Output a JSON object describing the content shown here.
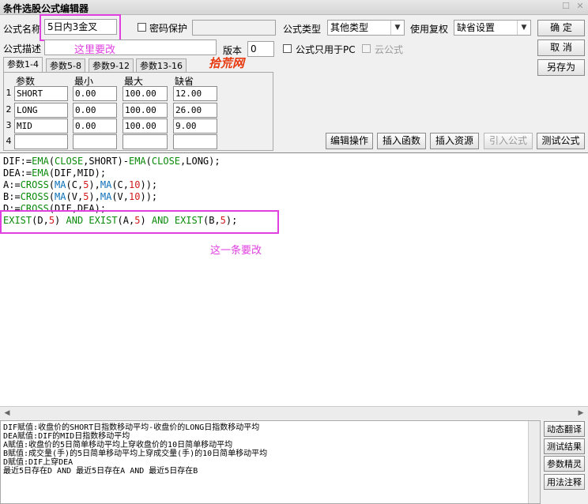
{
  "window": {
    "title": "条件选股公式编辑器",
    "restore_glyph": "☐",
    "close_glyph": "✕"
  },
  "form": {
    "name_label": "公式名称",
    "name_value": "5日内3金叉",
    "password_label": "密码保护",
    "type_label": "公式类型",
    "type_value": "其他类型",
    "rights_label": "使用复权",
    "rights_value": "缺省设置",
    "desc_label": "公式描述",
    "version_label": "版本",
    "version_value": "0",
    "pc_only_label": "公式只用于PC",
    "cloud_label": "云公式"
  },
  "buttons": {
    "ok": "确  定",
    "cancel": "取  消",
    "save_as": "另存为",
    "edit_op": "编辑操作",
    "insert_func": "插入函数",
    "insert_res": "插入资源",
    "import_formula": "引入公式",
    "test_formula": "测试公式",
    "dyn_translate": "动态翻译",
    "test_result": "测试结果",
    "param_wizard": "参数精灵",
    "usage_note": "用法注释"
  },
  "tabs": [
    "参数1-4",
    "参数5-8",
    "参数9-12",
    "参数13-16"
  ],
  "params": {
    "headers": [
      "参数",
      "最小",
      "最大",
      "缺省"
    ],
    "rows": [
      {
        "num": "1",
        "name": "SHORT",
        "min": "0.00",
        "max": "100.00",
        "def": "12.00"
      },
      {
        "num": "2",
        "name": "LONG",
        "min": "0.00",
        "max": "100.00",
        "def": "26.00"
      },
      {
        "num": "3",
        "name": "MID",
        "min": "0.00",
        "max": "100.00",
        "def": "9.00"
      },
      {
        "num": "4",
        "name": "",
        "min": "",
        "max": "",
        "def": ""
      }
    ]
  },
  "code": {
    "l1": [
      "DIF:=",
      "EMA",
      "(",
      "CLOSE",
      ",SHORT)-",
      "EMA",
      "(",
      "CLOSE",
      ",LONG);"
    ],
    "l2": [
      "DEA:=",
      "EMA",
      "(DIF,MID);"
    ],
    "l3": [
      "A:=",
      "CROSS",
      "(",
      "MA",
      "(C,",
      "5",
      "),",
      "MA",
      "(C,",
      "10",
      "));"
    ],
    "l4": [
      "B:=",
      "CROSS",
      "(",
      "MA",
      "(V,",
      "5",
      "),",
      "MA",
      "(V,",
      "10",
      "));"
    ],
    "l5": [
      "D:=",
      "CROSS",
      "(DIF,DEA);"
    ],
    "l6": [
      "EXIST",
      "(D,",
      "5",
      ") ",
      "AND",
      " ",
      "EXIST",
      "(A,",
      "5",
      ") ",
      "AND",
      " ",
      "EXIST",
      "(B,",
      "5",
      ");"
    ]
  },
  "description": [
    "DIF赋值:收盘价的SHORT日指数移动平均-收盘价的LONG日指数移动平均",
    "DEA赋值:DIF的MID日指数移动平均",
    "A赋值:收盘价的5日简单移动平均上穿收盘价的10日简单移动平均",
    "B赋值:成交量(手)的5日简单移动平均上穿成交量(手)的10日简单移动平均",
    "D赋值:DIF上穿DEA",
    "最近5日存在D AND 最近5日存在A AND 最近5日存在B"
  ],
  "annotations": {
    "name_note": "这里要改",
    "line_note": "这一条要改",
    "watermark": "拾荒网"
  },
  "colors": {
    "highlight": "#e040e0",
    "function_green": "#0a8a0a",
    "function_blue": "#0a6fb8",
    "number_red": "#d31a1a",
    "watermark": "#e8380d"
  }
}
